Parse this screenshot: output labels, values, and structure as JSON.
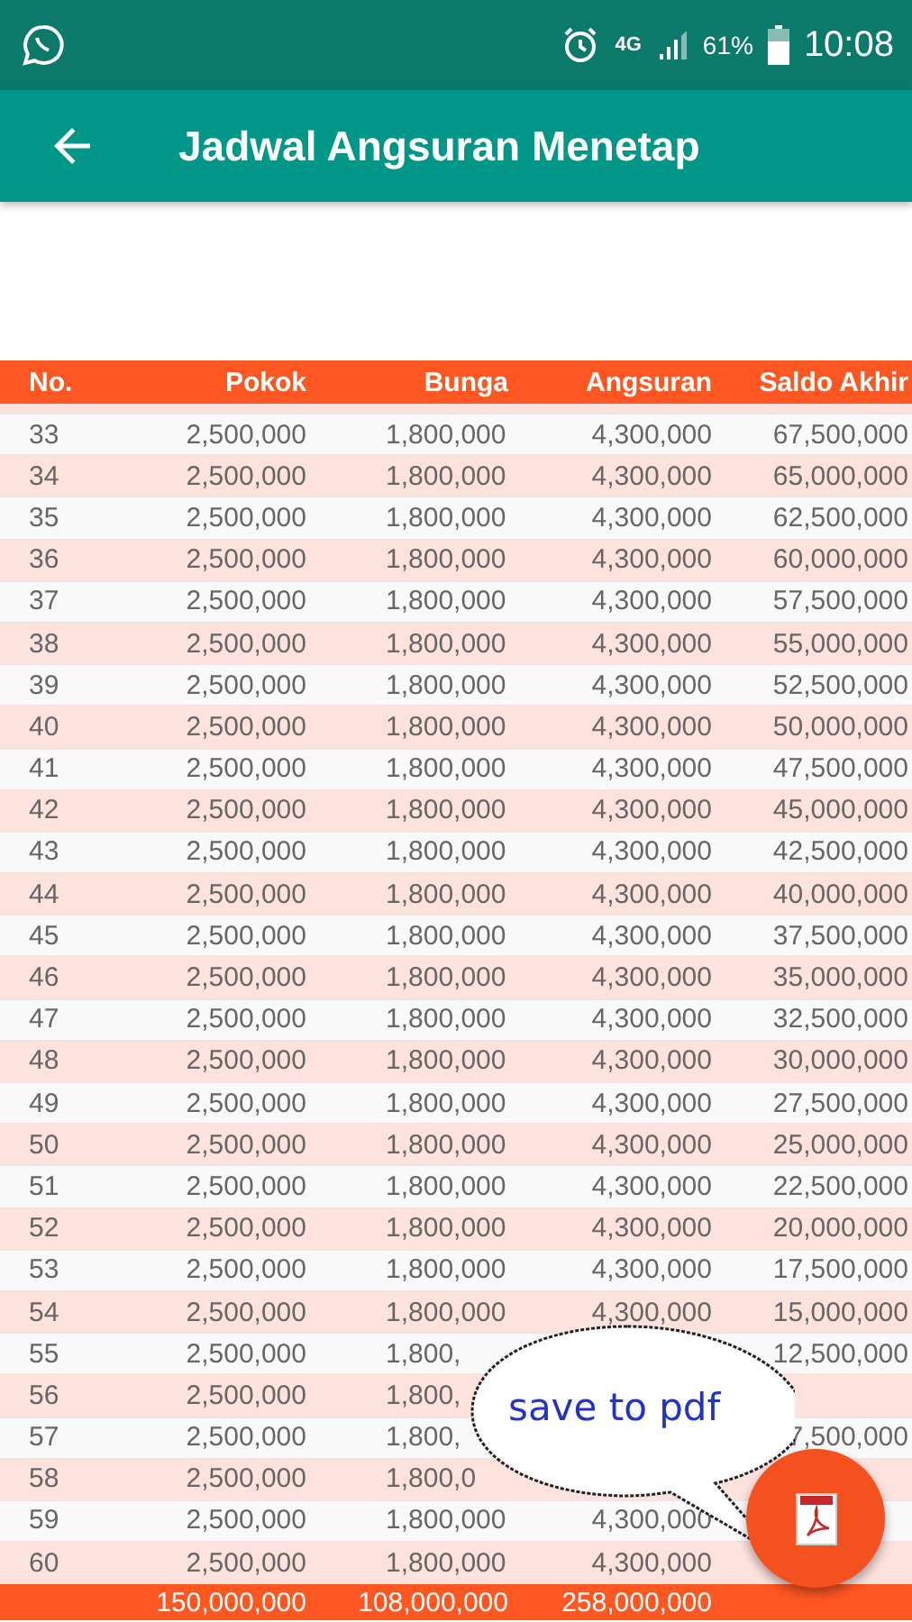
{
  "status_bar": {
    "network_type": "4G",
    "battery": "61%",
    "time": "10:08"
  },
  "toolbar": {
    "title": "Jadwal Angsuran Menetap"
  },
  "table": {
    "columns": [
      "No.",
      "Pokok",
      "Bunga",
      "Angsuran",
      "Saldo Akhir"
    ],
    "rows": [
      {
        "no": "33",
        "pokok": "2,500,000",
        "bunga": "1,800,000",
        "angsuran": "4,300,000",
        "saldo": "67,500,000"
      },
      {
        "no": "34",
        "pokok": "2,500,000",
        "bunga": "1,800,000",
        "angsuran": "4,300,000",
        "saldo": "65,000,000"
      },
      {
        "no": "35",
        "pokok": "2,500,000",
        "bunga": "1,800,000",
        "angsuran": "4,300,000",
        "saldo": "62,500,000"
      },
      {
        "no": "36",
        "pokok": "2,500,000",
        "bunga": "1,800,000",
        "angsuran": "4,300,000",
        "saldo": "60,000,000"
      },
      {
        "no": "37",
        "pokok": "2,500,000",
        "bunga": "1,800,000",
        "angsuran": "4,300,000",
        "saldo": "57,500,000"
      },
      {
        "no": "38",
        "pokok": "2,500,000",
        "bunga": "1,800,000",
        "angsuran": "4,300,000",
        "saldo": "55,000,000"
      },
      {
        "no": "39",
        "pokok": "2,500,000",
        "bunga": "1,800,000",
        "angsuran": "4,300,000",
        "saldo": "52,500,000"
      },
      {
        "no": "40",
        "pokok": "2,500,000",
        "bunga": "1,800,000",
        "angsuran": "4,300,000",
        "saldo": "50,000,000"
      },
      {
        "no": "41",
        "pokok": "2,500,000",
        "bunga": "1,800,000",
        "angsuran": "4,300,000",
        "saldo": "47,500,000"
      },
      {
        "no": "42",
        "pokok": "2,500,000",
        "bunga": "1,800,000",
        "angsuran": "4,300,000",
        "saldo": "45,000,000"
      },
      {
        "no": "43",
        "pokok": "2,500,000",
        "bunga": "1,800,000",
        "angsuran": "4,300,000",
        "saldo": "42,500,000"
      },
      {
        "no": "44",
        "pokok": "2,500,000",
        "bunga": "1,800,000",
        "angsuran": "4,300,000",
        "saldo": "40,000,000"
      },
      {
        "no": "45",
        "pokok": "2,500,000",
        "bunga": "1,800,000",
        "angsuran": "4,300,000",
        "saldo": "37,500,000"
      },
      {
        "no": "46",
        "pokok": "2,500,000",
        "bunga": "1,800,000",
        "angsuran": "4,300,000",
        "saldo": "35,000,000"
      },
      {
        "no": "47",
        "pokok": "2,500,000",
        "bunga": "1,800,000",
        "angsuran": "4,300,000",
        "saldo": "32,500,000"
      },
      {
        "no": "48",
        "pokok": "2,500,000",
        "bunga": "1,800,000",
        "angsuran": "4,300,000",
        "saldo": "30,000,000"
      },
      {
        "no": "49",
        "pokok": "2,500,000",
        "bunga": "1,800,000",
        "angsuran": "4,300,000",
        "saldo": "27,500,000"
      },
      {
        "no": "50",
        "pokok": "2,500,000",
        "bunga": "1,800,000",
        "angsuran": "4,300,000",
        "saldo": "25,000,000"
      },
      {
        "no": "51",
        "pokok": "2,500,000",
        "bunga": "1,800,000",
        "angsuran": "4,300,000",
        "saldo": "22,500,000"
      },
      {
        "no": "52",
        "pokok": "2,500,000",
        "bunga": "1,800,000",
        "angsuran": "4,300,000",
        "saldo": "20,000,000"
      },
      {
        "no": "53",
        "pokok": "2,500,000",
        "bunga": "1,800,000",
        "angsuran": "4,300,000",
        "saldo": "17,500,000"
      },
      {
        "no": "54",
        "pokok": "2,500,000",
        "bunga": "1,800,000",
        "angsuran": "4,300,000",
        "saldo": "15,000,000"
      },
      {
        "no": "55",
        "pokok": "2,500,000",
        "bunga": "1,800,",
        "saldo": "12,500,000"
      },
      {
        "no": "56",
        "pokok": "2,500,000",
        "bunga": "1,800,"
      },
      {
        "no": "57",
        "pokok": "2,500,000",
        "bunga": "1,800,",
        "saldo": "7,500,000"
      },
      {
        "no": "58",
        "pokok": "2,500,000",
        "bunga": "1,800,0"
      },
      {
        "no": "59",
        "pokok": "2,500,000",
        "bunga": "1,800,000",
        "angsuran": "4,300,000"
      },
      {
        "no": "60",
        "pokok": "2,500,000",
        "bunga": "1,800,000",
        "angsuran": "4,300,000"
      }
    ],
    "totals": {
      "pokok": "150,000,000",
      "bunga": "108,000,000",
      "angsuran": "258,000,000"
    }
  },
  "callout": {
    "text": "save to pdf"
  }
}
